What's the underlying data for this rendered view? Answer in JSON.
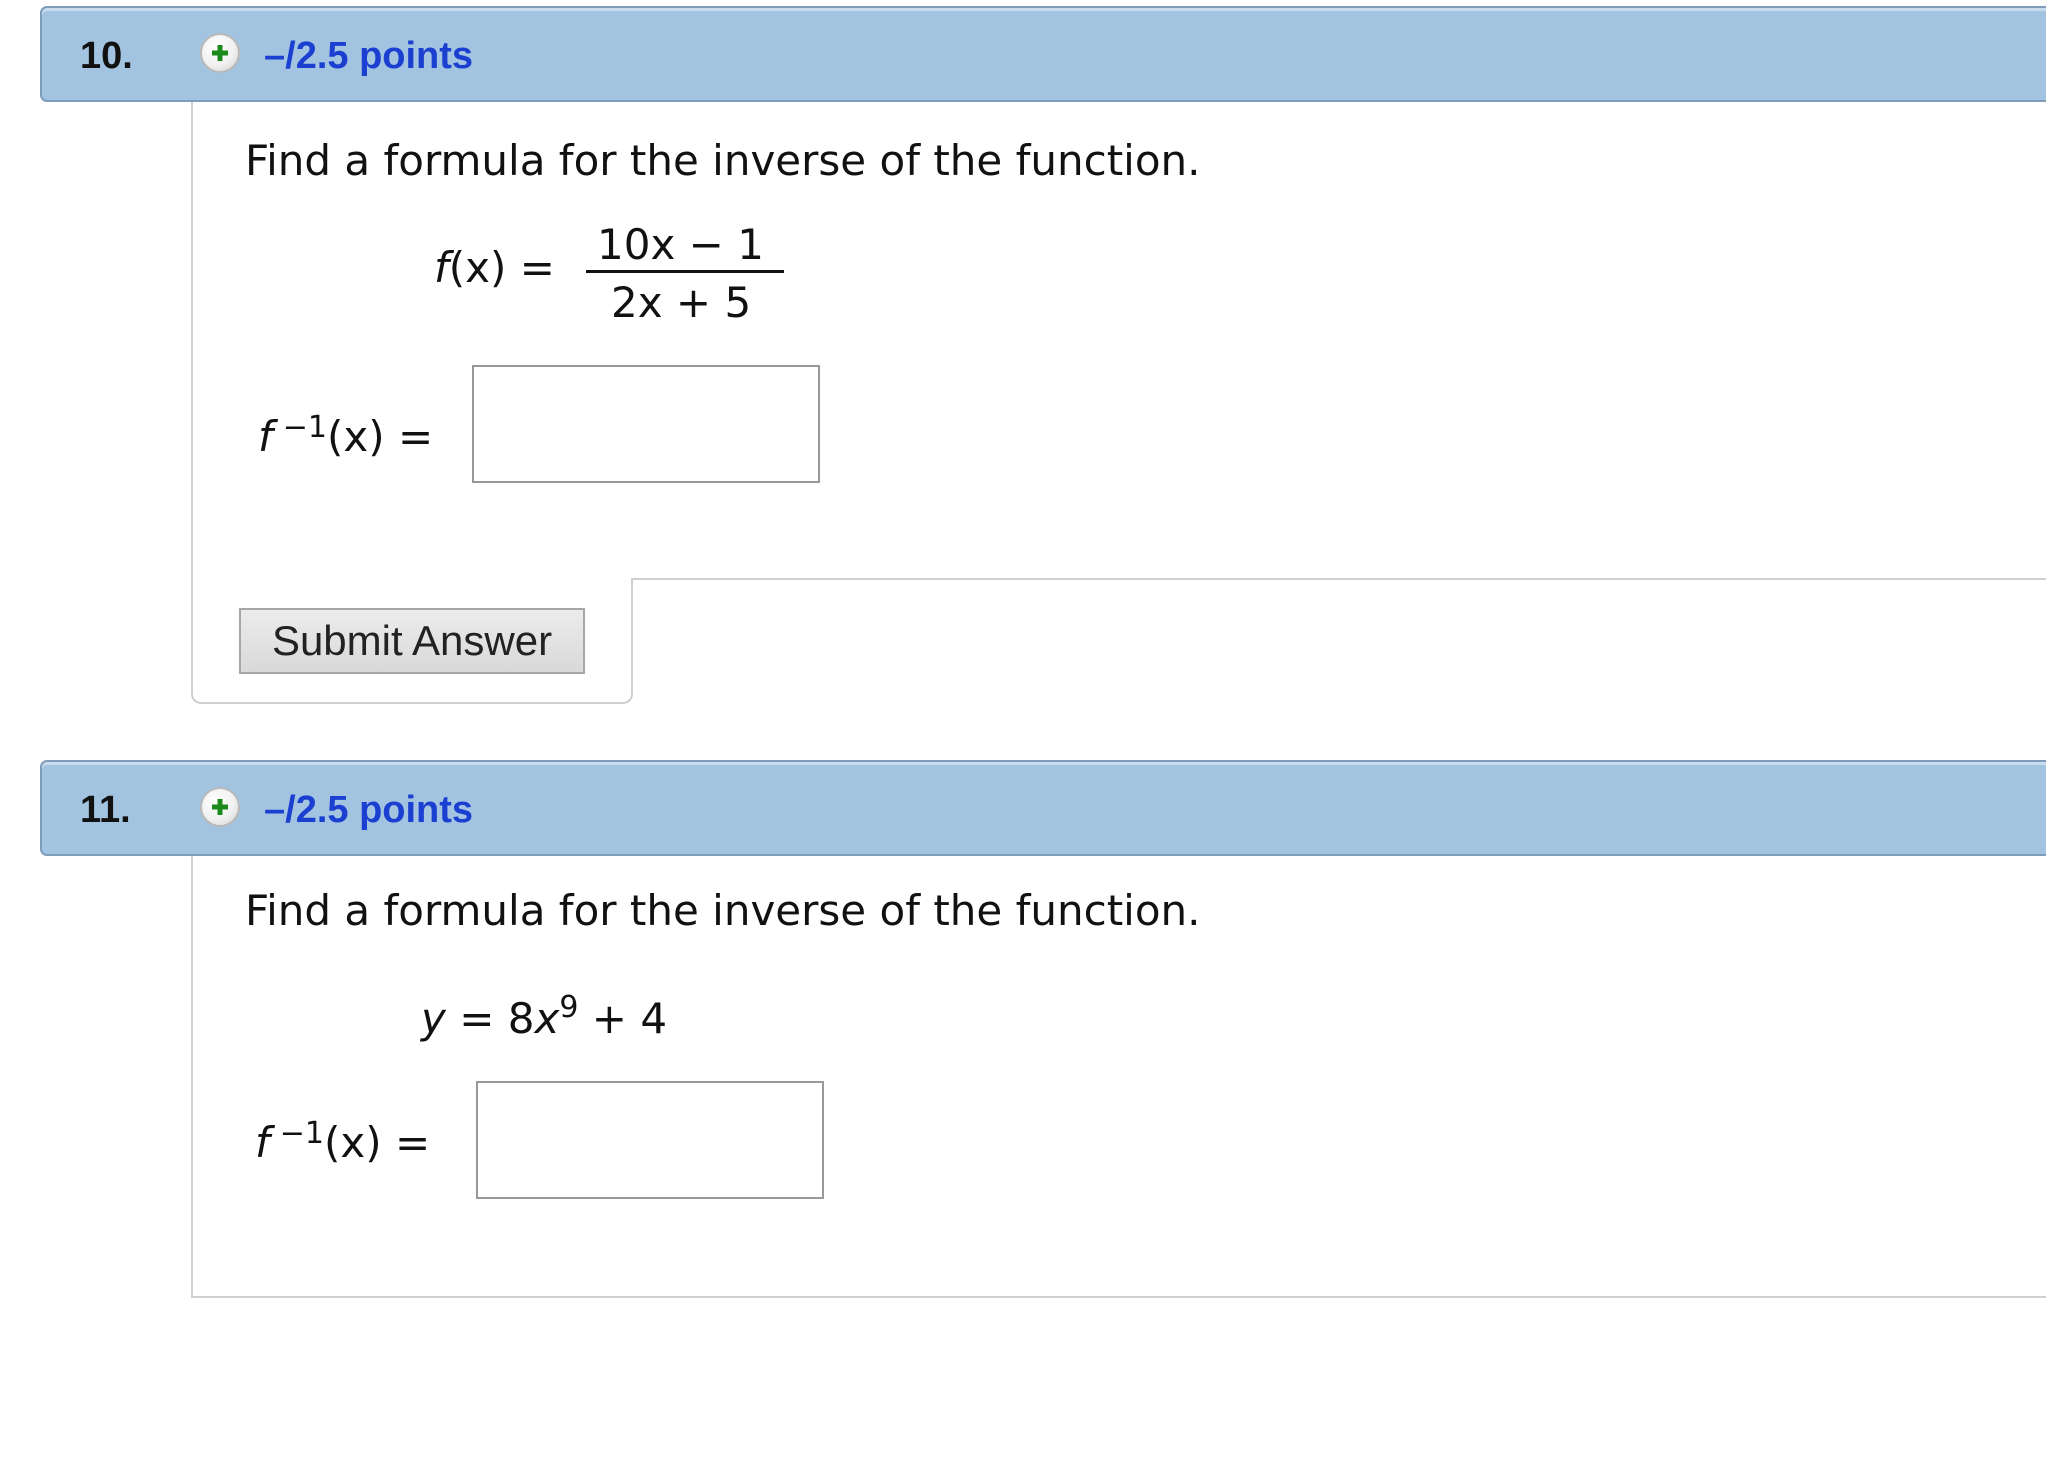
{
  "questions": [
    {
      "number": "10.",
      "points": "–/2.5 points",
      "prompt": "Find a formula for the inverse of the function.",
      "function": {
        "lhs_f": "f",
        "lhs_x": "(x) =",
        "numerator": "10x − 1",
        "denominator": "2x + 5"
      },
      "answer_label": {
        "f": "f",
        "sup": "−1",
        "rest": "(x) ="
      },
      "answer_value": "",
      "submit_label": "Submit Answer"
    },
    {
      "number": "11.",
      "points": "–/2.5 points",
      "prompt": "Find a formula for the inverse of the function.",
      "function": {
        "y": "y",
        "eq": " = 8",
        "x": "x",
        "exp": "9",
        "tail": " + 4"
      },
      "answer_label": {
        "f": "f",
        "sup": "−1",
        "rest": "(x) ="
      },
      "answer_value": ""
    }
  ],
  "icons": {
    "expand": "plus-circle-icon"
  },
  "colors": {
    "header_bg": "#a3c4e1",
    "points_link": "#1b3fd0",
    "plus_green": "#1a8a1a"
  }
}
